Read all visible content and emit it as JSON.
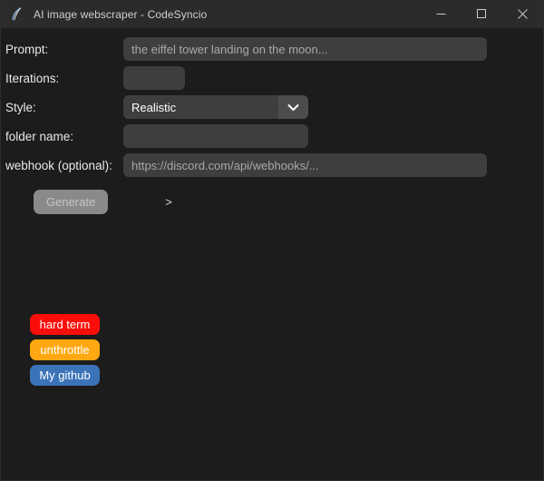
{
  "window": {
    "title": "AI image webscraper - CodeSyncio",
    "icon": "feather-icon",
    "background_color": "#1c1c1c",
    "titlebar_color": "#2b2b2b",
    "controls": [
      {
        "name": "minimize",
        "glyph": "—"
      },
      {
        "name": "maximize",
        "glyph": "☐"
      },
      {
        "name": "close",
        "glyph": "✕"
      }
    ]
  },
  "form": {
    "prompt": {
      "label": "Prompt:",
      "value": "",
      "placeholder": "the eiffel tower landing on the moon..."
    },
    "iterations": {
      "label": "Iterations:",
      "value": "",
      "placeholder": ""
    },
    "style": {
      "label": "Style:",
      "selected": "Realistic",
      "arrow_icon": "chevron-down-icon"
    },
    "folder_name": {
      "label": "folder name:",
      "value": "",
      "placeholder": ""
    },
    "webhook": {
      "label": "webhook (optional):",
      "value": "",
      "placeholder": "https://discord.com/api/webhooks/..."
    },
    "generate": {
      "label": "Generate",
      "color": "#8a8a8a",
      "text_color": "#c6c6c6"
    },
    "status_marker": ">"
  },
  "actions": [
    {
      "label": "hard term",
      "color": "#fb0d09",
      "name": "hard-term-button"
    },
    {
      "label": "unthrottle",
      "color": "#ffa812",
      "name": "unthrottle-button"
    },
    {
      "label": "My github",
      "color": "#3b73b9",
      "name": "my-github-button"
    }
  ]
}
